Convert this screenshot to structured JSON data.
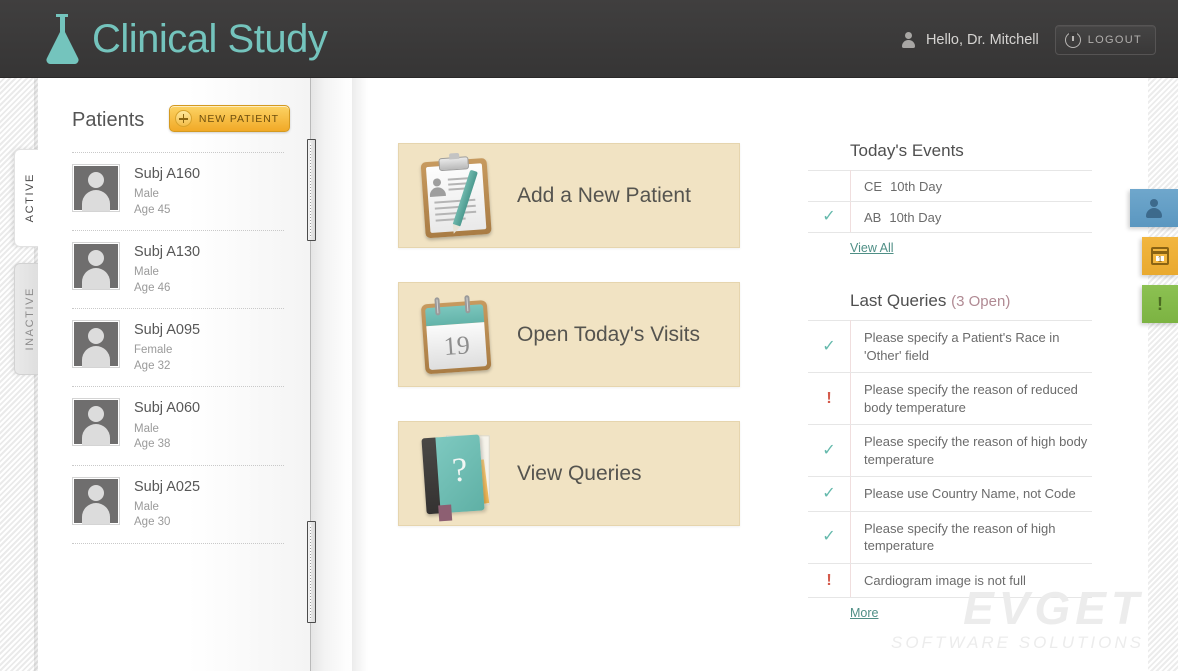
{
  "header": {
    "brand": "Clinical Study",
    "logo_icon": "flask-icon",
    "user_icon": "user-icon",
    "greeting": "Hello, Dr. Mitchell",
    "logout_label": "LOGOUT",
    "logout_icon": "power-icon",
    "bg_color": "#3b3a3a",
    "brand_color": "#74c4bd"
  },
  "side_tabs_left": [
    {
      "label": "ACTIVE",
      "selected": true
    },
    {
      "label": "INACTIVE",
      "selected": false
    }
  ],
  "patients": {
    "title": "Patients",
    "new_patient_label": "NEW PATIENT",
    "new_patient_icon": "plus-icon",
    "accent_color": "#f1a927",
    "items": [
      {
        "name": "Subj A160",
        "sex": "Male",
        "age": "Age 45"
      },
      {
        "name": "Subj A130",
        "sex": "Male",
        "age": "Age 46"
      },
      {
        "name": "Subj A095",
        "sex": "Female",
        "age": "Age 32"
      },
      {
        "name": "Subj A060",
        "sex": "Male",
        "age": "Age 38"
      },
      {
        "name": "Subj A025",
        "sex": "Male",
        "age": "Age 30"
      }
    ]
  },
  "cards": [
    {
      "label": "Add a New Patient",
      "icon": "clipboard-icon"
    },
    {
      "label": "Open Today's Visits",
      "icon": "calendar-icon",
      "calendar_day": "19"
    },
    {
      "label": "View Queries",
      "icon": "question-book-icon"
    }
  ],
  "card_style": {
    "bg": "#f1e3c3",
    "border": "#e6d5ae"
  },
  "events": {
    "title": "Today's Events",
    "rows": [
      {
        "status": "none",
        "code": "CE",
        "text": "10th Day"
      },
      {
        "status": "check",
        "code": "AB",
        "text": "10th Day"
      }
    ],
    "link": "View All"
  },
  "queries": {
    "title": "Last Queries",
    "open_count": "(3 Open)",
    "rows": [
      {
        "status": "check",
        "text": "Please specify a Patient's Race in 'Other' field"
      },
      {
        "status": "alert",
        "text": "Please specify the reason of reduced body temperature"
      },
      {
        "status": "check",
        "text": "Please specify the reason of high body temperature"
      },
      {
        "status": "check",
        "text": "Please use Country Name, not Code"
      },
      {
        "status": "check",
        "text": "Please specify the reason of high temperature"
      },
      {
        "status": "alert",
        "text": "Cardiogram image is not full"
      }
    ],
    "link": "More"
  },
  "side_tabs_right": [
    {
      "icon": "person-icon",
      "color": "#5b97c0"
    },
    {
      "icon": "calendar-icon",
      "color": "#e9a92f"
    },
    {
      "icon": "alert-icon",
      "color": "#7cb342"
    }
  ],
  "watermark": {
    "line1": "EVGET",
    "line2": "SOFTWARE SOLUTIONS"
  }
}
